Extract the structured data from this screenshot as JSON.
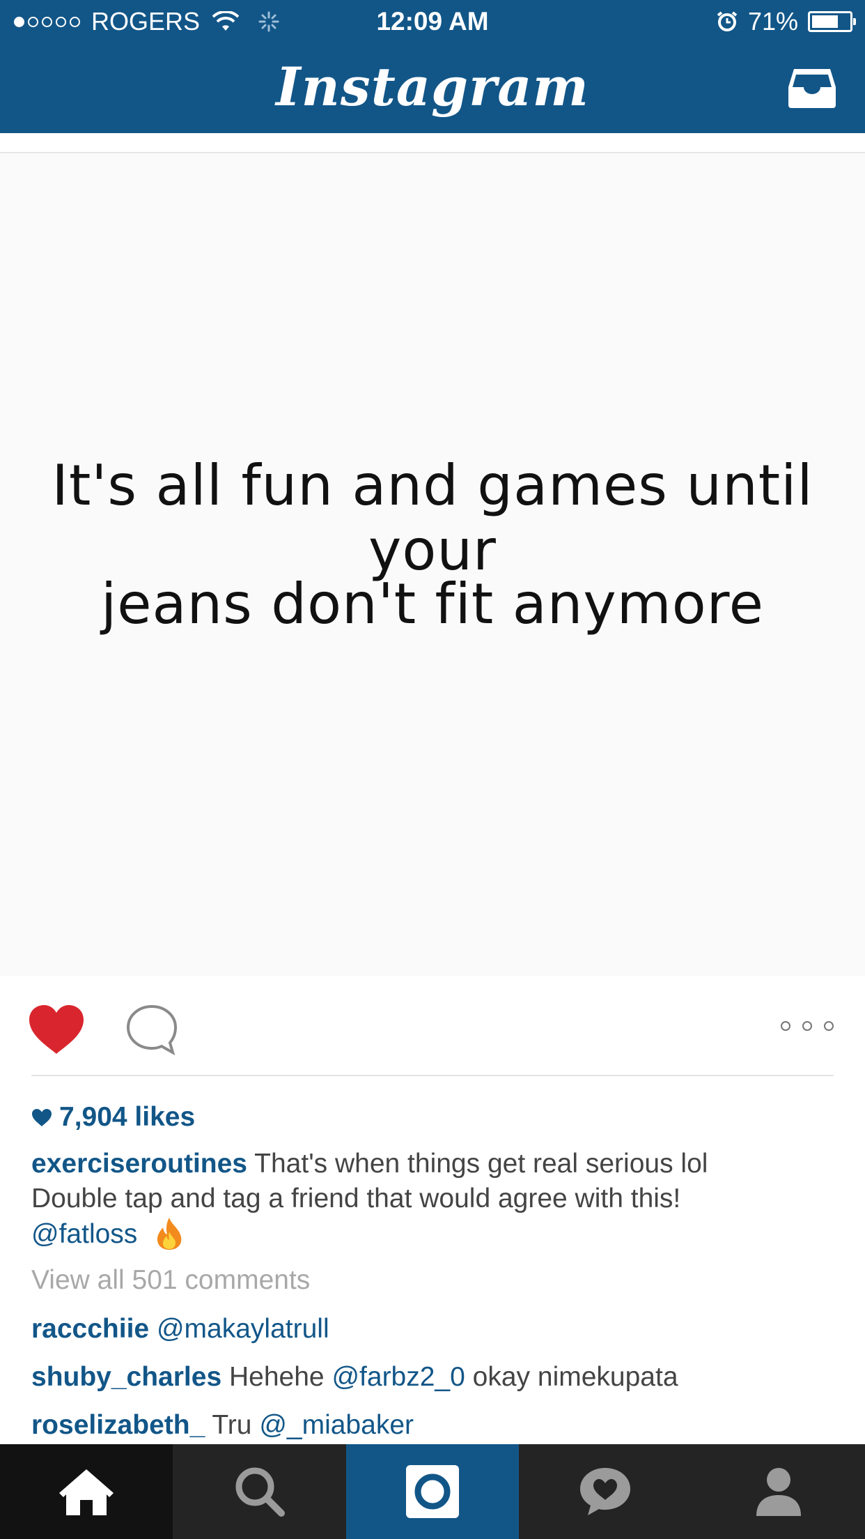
{
  "status_bar": {
    "carrier": "ROGERS",
    "time": "12:09 AM",
    "battery_percent": "71%",
    "battery_level": 0.71,
    "signal_bars_filled": 1,
    "signal_bars_total": 5,
    "icons": [
      "wifi-icon",
      "activity-spinner-icon",
      "alarm-icon",
      "battery-icon"
    ]
  },
  "nav": {
    "title": "Instagram",
    "inbox_icon": "inbox-icon"
  },
  "post": {
    "image_text": {
      "line1": "It's all fun and games until your",
      "line2": "jeans don't fit anymore"
    },
    "liked": true,
    "likes": "7,904 likes",
    "caption": {
      "username": "exerciseroutines",
      "text_line1": "That's when things get real serious lol",
      "text_line2": "Double tap and tag a friend that would agree with this!",
      "mention": "@fatloss",
      "emoji": "fire-emoji"
    },
    "view_all_comments": "View all 501 comments",
    "comments": [
      {
        "username": "raccchiie",
        "mention": "@makaylatrull",
        "text_before": "",
        "text_after": ""
      },
      {
        "username": "shuby_charles",
        "text_before": "Hehehe",
        "mention": "@farbz2_0",
        "text_after": "okay nimekupata"
      },
      {
        "username": "roselizabeth_",
        "text_before": "Tru",
        "mention": "@_miabaker",
        "text_after": ""
      }
    ]
  },
  "tab_bar": {
    "tabs": [
      "home",
      "search",
      "camera",
      "activity",
      "profile"
    ],
    "active": "home"
  },
  "colors": {
    "brand_blue": "#125688",
    "like_red": "#d9262e",
    "tab_bar": "#242424",
    "text_gray": "#444444"
  }
}
